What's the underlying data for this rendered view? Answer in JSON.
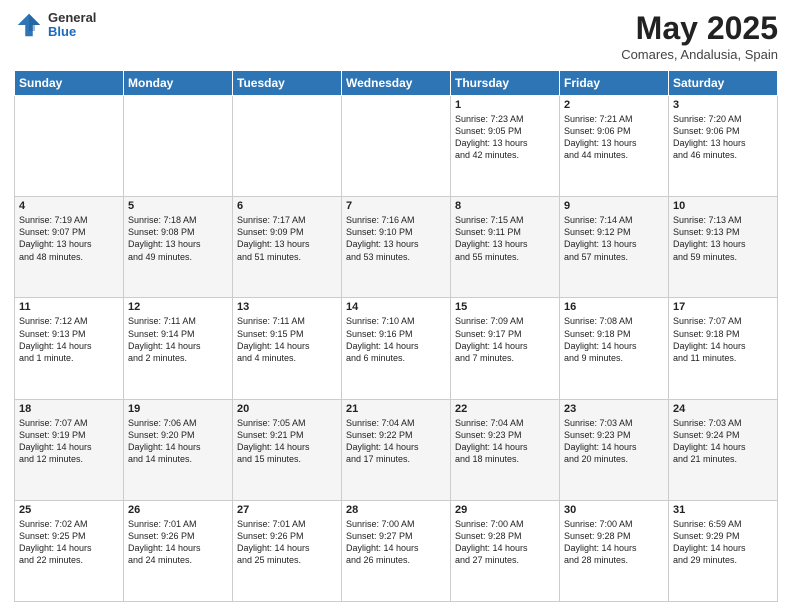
{
  "header": {
    "logo_general": "General",
    "logo_blue": "Blue",
    "main_title": "May 2025",
    "subtitle": "Comares, Andalusia, Spain"
  },
  "calendar": {
    "days_of_week": [
      "Sunday",
      "Monday",
      "Tuesday",
      "Wednesday",
      "Thursday",
      "Friday",
      "Saturday"
    ],
    "weeks": [
      [
        {
          "day": "",
          "info": ""
        },
        {
          "day": "",
          "info": ""
        },
        {
          "day": "",
          "info": ""
        },
        {
          "day": "",
          "info": ""
        },
        {
          "day": "1",
          "info": "Sunrise: 7:23 AM\nSunset: 9:05 PM\nDaylight: 13 hours\nand 42 minutes."
        },
        {
          "day": "2",
          "info": "Sunrise: 7:21 AM\nSunset: 9:06 PM\nDaylight: 13 hours\nand 44 minutes."
        },
        {
          "day": "3",
          "info": "Sunrise: 7:20 AM\nSunset: 9:06 PM\nDaylight: 13 hours\nand 46 minutes."
        }
      ],
      [
        {
          "day": "4",
          "info": "Sunrise: 7:19 AM\nSunset: 9:07 PM\nDaylight: 13 hours\nand 48 minutes."
        },
        {
          "day": "5",
          "info": "Sunrise: 7:18 AM\nSunset: 9:08 PM\nDaylight: 13 hours\nand 49 minutes."
        },
        {
          "day": "6",
          "info": "Sunrise: 7:17 AM\nSunset: 9:09 PM\nDaylight: 13 hours\nand 51 minutes."
        },
        {
          "day": "7",
          "info": "Sunrise: 7:16 AM\nSunset: 9:10 PM\nDaylight: 13 hours\nand 53 minutes."
        },
        {
          "day": "8",
          "info": "Sunrise: 7:15 AM\nSunset: 9:11 PM\nDaylight: 13 hours\nand 55 minutes."
        },
        {
          "day": "9",
          "info": "Sunrise: 7:14 AM\nSunset: 9:12 PM\nDaylight: 13 hours\nand 57 minutes."
        },
        {
          "day": "10",
          "info": "Sunrise: 7:13 AM\nSunset: 9:13 PM\nDaylight: 13 hours\nand 59 minutes."
        }
      ],
      [
        {
          "day": "11",
          "info": "Sunrise: 7:12 AM\nSunset: 9:13 PM\nDaylight: 14 hours\nand 1 minute."
        },
        {
          "day": "12",
          "info": "Sunrise: 7:11 AM\nSunset: 9:14 PM\nDaylight: 14 hours\nand 2 minutes."
        },
        {
          "day": "13",
          "info": "Sunrise: 7:11 AM\nSunset: 9:15 PM\nDaylight: 14 hours\nand 4 minutes."
        },
        {
          "day": "14",
          "info": "Sunrise: 7:10 AM\nSunset: 9:16 PM\nDaylight: 14 hours\nand 6 minutes."
        },
        {
          "day": "15",
          "info": "Sunrise: 7:09 AM\nSunset: 9:17 PM\nDaylight: 14 hours\nand 7 minutes."
        },
        {
          "day": "16",
          "info": "Sunrise: 7:08 AM\nSunset: 9:18 PM\nDaylight: 14 hours\nand 9 minutes."
        },
        {
          "day": "17",
          "info": "Sunrise: 7:07 AM\nSunset: 9:18 PM\nDaylight: 14 hours\nand 11 minutes."
        }
      ],
      [
        {
          "day": "18",
          "info": "Sunrise: 7:07 AM\nSunset: 9:19 PM\nDaylight: 14 hours\nand 12 minutes."
        },
        {
          "day": "19",
          "info": "Sunrise: 7:06 AM\nSunset: 9:20 PM\nDaylight: 14 hours\nand 14 minutes."
        },
        {
          "day": "20",
          "info": "Sunrise: 7:05 AM\nSunset: 9:21 PM\nDaylight: 14 hours\nand 15 minutes."
        },
        {
          "day": "21",
          "info": "Sunrise: 7:04 AM\nSunset: 9:22 PM\nDaylight: 14 hours\nand 17 minutes."
        },
        {
          "day": "22",
          "info": "Sunrise: 7:04 AM\nSunset: 9:23 PM\nDaylight: 14 hours\nand 18 minutes."
        },
        {
          "day": "23",
          "info": "Sunrise: 7:03 AM\nSunset: 9:23 PM\nDaylight: 14 hours\nand 20 minutes."
        },
        {
          "day": "24",
          "info": "Sunrise: 7:03 AM\nSunset: 9:24 PM\nDaylight: 14 hours\nand 21 minutes."
        }
      ],
      [
        {
          "day": "25",
          "info": "Sunrise: 7:02 AM\nSunset: 9:25 PM\nDaylight: 14 hours\nand 22 minutes."
        },
        {
          "day": "26",
          "info": "Sunrise: 7:01 AM\nSunset: 9:26 PM\nDaylight: 14 hours\nand 24 minutes."
        },
        {
          "day": "27",
          "info": "Sunrise: 7:01 AM\nSunset: 9:26 PM\nDaylight: 14 hours\nand 25 minutes."
        },
        {
          "day": "28",
          "info": "Sunrise: 7:00 AM\nSunset: 9:27 PM\nDaylight: 14 hours\nand 26 minutes."
        },
        {
          "day": "29",
          "info": "Sunrise: 7:00 AM\nSunset: 9:28 PM\nDaylight: 14 hours\nand 27 minutes."
        },
        {
          "day": "30",
          "info": "Sunrise: 7:00 AM\nSunset: 9:28 PM\nDaylight: 14 hours\nand 28 minutes."
        },
        {
          "day": "31",
          "info": "Sunrise: 6:59 AM\nSunset: 9:29 PM\nDaylight: 14 hours\nand 29 minutes."
        }
      ]
    ]
  }
}
